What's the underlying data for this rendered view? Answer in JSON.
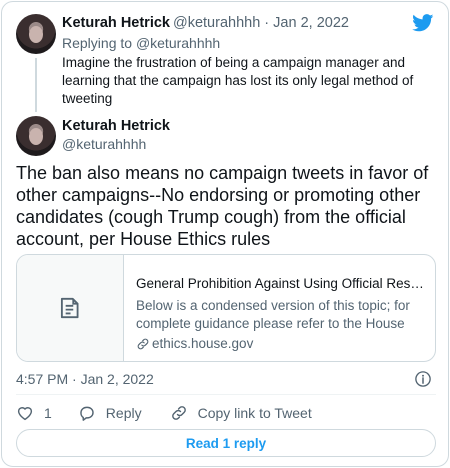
{
  "reply_tweet": {
    "author_name": "Keturah Hetrick",
    "handle": "@keturahhhh",
    "separator": "·",
    "date": "Jan 2, 2022",
    "replying_prefix": "Replying to",
    "replying_to": "@keturahhhh",
    "text": "Imagine the frustration of being a campaign manager and learning that the campaign has lost its only legal method of tweeting"
  },
  "main_tweet": {
    "author_name": "Keturah Hetrick",
    "handle": "@keturahhhh",
    "text": "The ban also means no campaign tweets in favor of other campaigns--No endorsing or promoting other candidates (cough Trump cough) from the official account, per House Ethics rules",
    "timestamp": "4:57 PM · Jan 2, 2022"
  },
  "link_card": {
    "title": "General Prohibition Against Using Official Resources for Campaign or Political Purposes",
    "description": "Below is a condensed version of this topic; for complete guidance please refer to the House Ethics Manual.",
    "domain": "ethics.house.gov"
  },
  "actions": {
    "like_count": "1",
    "reply_label": "Reply",
    "copy_link_label": "Copy link to Tweet"
  },
  "read_replies_label": "Read 1 reply",
  "colors": {
    "accent": "#1d9bf0",
    "muted": "#536471",
    "text": "#0f1419",
    "border": "#cfd9de"
  },
  "icons": [
    "twitter-bird-icon",
    "document-icon",
    "link-icon",
    "info-icon",
    "heart-icon",
    "reply-bubble-icon",
    "link-chain-icon"
  ]
}
